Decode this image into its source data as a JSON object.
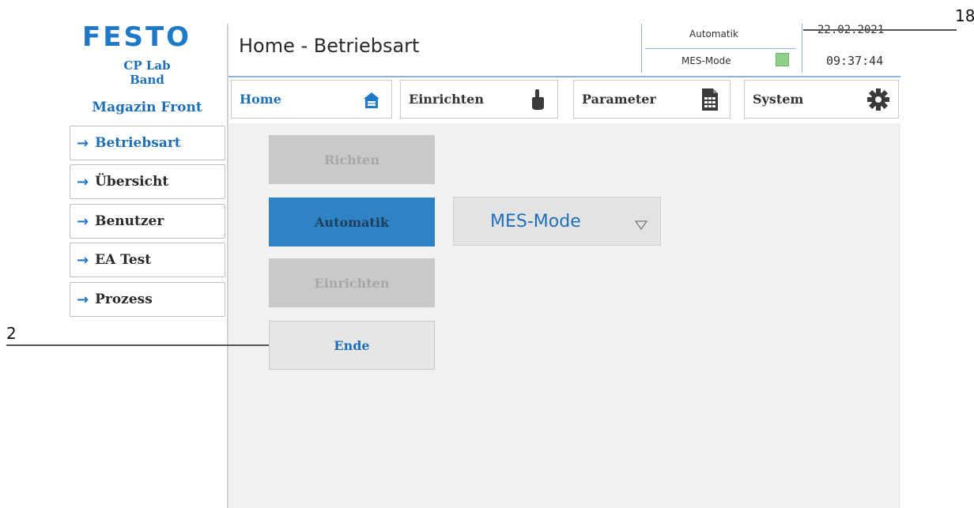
{
  "station": {
    "logo": "FESTO",
    "line1": "CP Lab",
    "line2": "Band",
    "line3": "Magazin Front"
  },
  "header": {
    "title": "Home - Betriebsart",
    "mode": "Automatik",
    "mes_label": "MES-Mode",
    "mes_indicator_color": "#8fd08a",
    "date": "22.02.2021",
    "time": "09:37:44"
  },
  "tabs": [
    {
      "label": "Home",
      "icon": "home-icon"
    },
    {
      "label": "Einrichten",
      "icon": "hand-pointer-icon"
    },
    {
      "label": "Parameter",
      "icon": "document-grid-icon"
    },
    {
      "label": "System",
      "icon": "gear-icon"
    }
  ],
  "sidebar": {
    "items": [
      {
        "label": "Betriebsart"
      },
      {
        "label": "Übersicht"
      },
      {
        "label": "Benutzer"
      },
      {
        "label": "EA Test"
      },
      {
        "label": "Prozess"
      }
    ]
  },
  "main": {
    "buttons": {
      "richten": "Richten",
      "automatik": "Automatik",
      "einrichten": "Einrichten",
      "ende": "Ende"
    },
    "dropdown": {
      "selected": "MES-Mode"
    }
  },
  "callouts": {
    "label_18": "18",
    "label_2": "2"
  },
  "colors": {
    "accent": "#1f79c6",
    "primary_button": "#2f83c4",
    "disabled_button": "#c9c9c9"
  }
}
